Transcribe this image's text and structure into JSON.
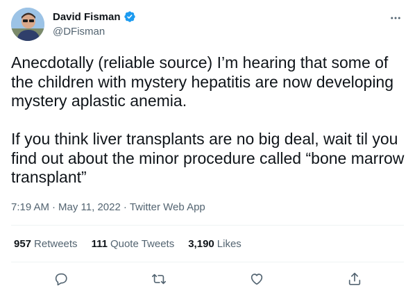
{
  "author": {
    "name": "David Fisman",
    "handle": "@DFisman",
    "avatar_icon": "person-photo-avatar",
    "verified_color": "#1d9bf0"
  },
  "tweet": {
    "text": "Anecdotally (reliable source) I’m hearing that some of the children with mystery hepatitis are now developing mystery aplastic anemia.\n\nIf you think liver transplants are no big deal, wait til you find out about the minor procedure called “bone marrow transplant”",
    "time": "7:19 AM",
    "date": "May 11, 2022",
    "source": "Twitter Web App",
    "separator": "·"
  },
  "stats": {
    "retweets": {
      "count": "957",
      "label": "Retweets"
    },
    "quotes": {
      "count": "111",
      "label": "Quote Tweets"
    },
    "likes": {
      "count": "3,190",
      "label": "Likes"
    }
  },
  "actions": {
    "reply_icon": "reply-icon",
    "retweet_icon": "retweet-icon",
    "like_icon": "like-icon",
    "share_icon": "share-icon",
    "icon_color": "#536471"
  }
}
